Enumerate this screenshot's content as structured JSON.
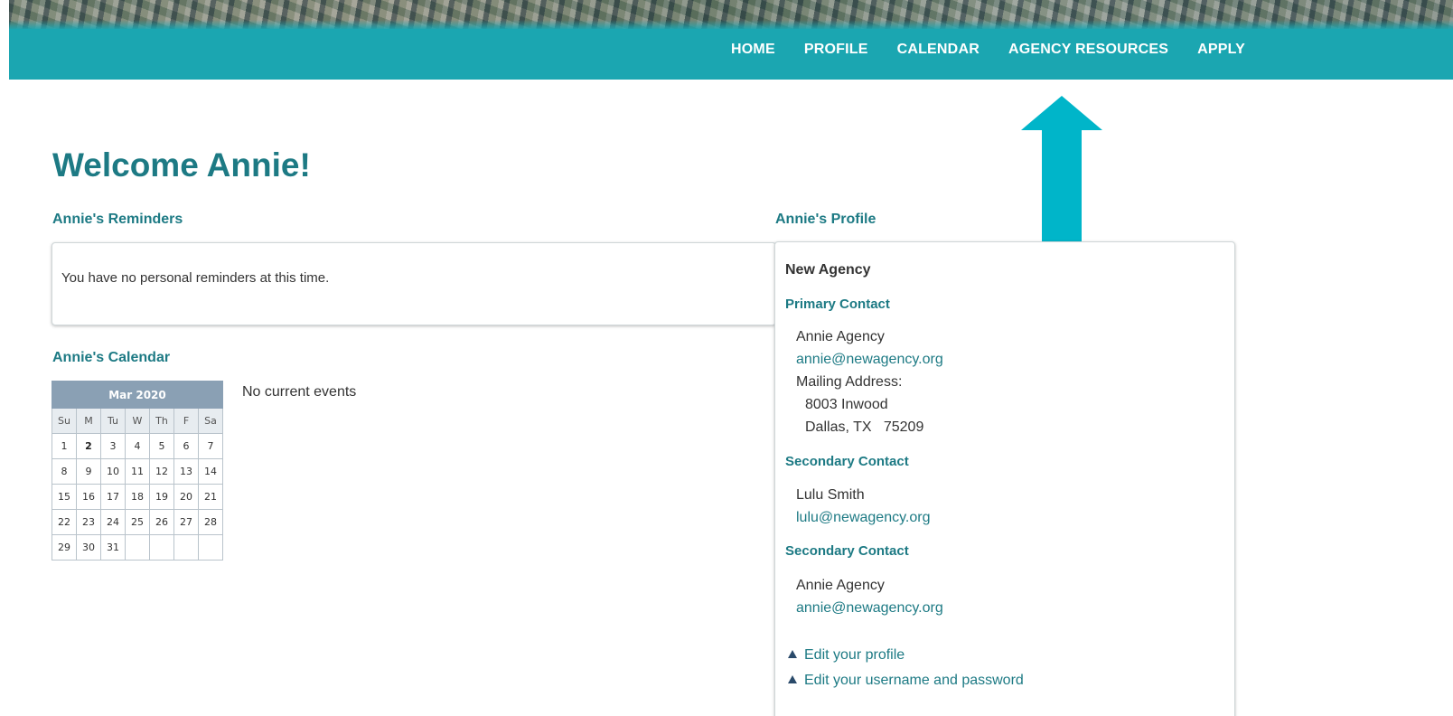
{
  "nav": {
    "items": [
      {
        "label": "HOME"
      },
      {
        "label": "PROFILE"
      },
      {
        "label": "CALENDAR"
      },
      {
        "label": "AGENCY RESOURCES"
      },
      {
        "label": "APPLY"
      }
    ]
  },
  "welcome": "Welcome Annie!",
  "reminders": {
    "title": "Annie's Reminders",
    "message": "You have no personal reminders at this time."
  },
  "calendar": {
    "title": "Annie's Calendar",
    "month_label": "Mar 2020",
    "weekdays": [
      "Su",
      "M",
      "Tu",
      "W",
      "Th",
      "F",
      "Sa"
    ],
    "weeks": [
      [
        "1",
        "2",
        "3",
        "4",
        "5",
        "6",
        "7"
      ],
      [
        "8",
        "9",
        "10",
        "11",
        "12",
        "13",
        "14"
      ],
      [
        "15",
        "16",
        "17",
        "18",
        "19",
        "20",
        "21"
      ],
      [
        "22",
        "23",
        "24",
        "25",
        "26",
        "27",
        "28"
      ],
      [
        "29",
        "30",
        "31",
        "",
        "",
        "",
        ""
      ]
    ],
    "today": "2",
    "events_message": "No current events"
  },
  "profile": {
    "title": "Annie's Profile",
    "agency_name": "New Agency",
    "primary_contact": {
      "heading": "Primary Contact",
      "name": "Annie Agency",
      "email": "annie@newagency.org",
      "mailing_label": "Mailing Address:",
      "address_line1": "8003 Inwood",
      "address_line2": "Dallas, TX   75209"
    },
    "secondary_contacts": [
      {
        "heading": "Secondary Contact",
        "name": "Lulu Smith",
        "email": "lulu@newagency.org"
      },
      {
        "heading": "Secondary Contact",
        "name": "Annie Agency",
        "email": "annie@newagency.org"
      }
    ],
    "actions": [
      {
        "label": "Edit your profile",
        "icon": "triangle-up-icon"
      },
      {
        "label": "Edit your username and password",
        "icon": "triangle-up-icon"
      }
    ]
  },
  "colors": {
    "header": "#1ba6b1",
    "heading": "#1d7a84",
    "arrow": "#00b5c9",
    "calendar_header": "#8aa0b4"
  }
}
